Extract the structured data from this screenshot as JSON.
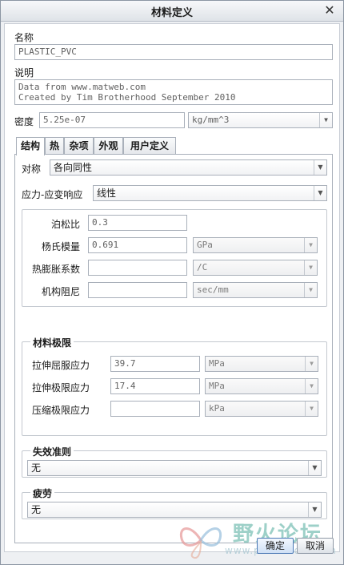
{
  "window": {
    "title": "材料定义",
    "close_symbol": "✕"
  },
  "name": {
    "label": "名称",
    "value": "PLASTIC_PVC"
  },
  "description": {
    "label": "说明",
    "lines": [
      "Data from www.matweb.com",
      "Created by Tim Brotherhood September 2010"
    ]
  },
  "density": {
    "label": "密度",
    "value": "5.25e-07",
    "unit": "kg/mm^3"
  },
  "tabs": [
    {
      "label": "结构",
      "active": true
    },
    {
      "label": "热",
      "active": false
    },
    {
      "label": "杂项",
      "active": false
    },
    {
      "label": "外观",
      "active": false
    },
    {
      "label": "用户定义",
      "active": false
    }
  ],
  "structural": {
    "symmetry": {
      "label": "对称",
      "value": "各向同性"
    },
    "stress_strain": {
      "label": "应力-应变响应",
      "value": "线性"
    },
    "properties": {
      "poisson": {
        "label": "泊松比",
        "value": "0.3"
      },
      "youngs": {
        "label": "杨氏模量",
        "value": "0.691",
        "unit": "GPa"
      },
      "thermal_expansion": {
        "label": "热膨胀系数",
        "value": "",
        "unit": "/C"
      },
      "damping": {
        "label": "机构阻尼",
        "value": "",
        "unit": "sec/mm"
      }
    },
    "limits": {
      "title": "材料极限",
      "tensile_yield": {
        "label": "拉伸屈服应力",
        "value": "39.7",
        "unit": "MPa"
      },
      "tensile_ultimate": {
        "label": "拉伸极限应力",
        "value": "17.4",
        "unit": "MPa"
      },
      "compressive_ultimate": {
        "label": "压缩极限应力",
        "value": "",
        "unit": "kPa"
      }
    },
    "failure": {
      "title": "失效准则",
      "value": "无"
    },
    "fatigue": {
      "title": "疲劳",
      "value": "无"
    }
  },
  "buttons": {
    "ok": "确定",
    "cancel": "取消"
  },
  "watermark": {
    "text": "野火论坛",
    "url": "www.proewildfire.cn"
  }
}
